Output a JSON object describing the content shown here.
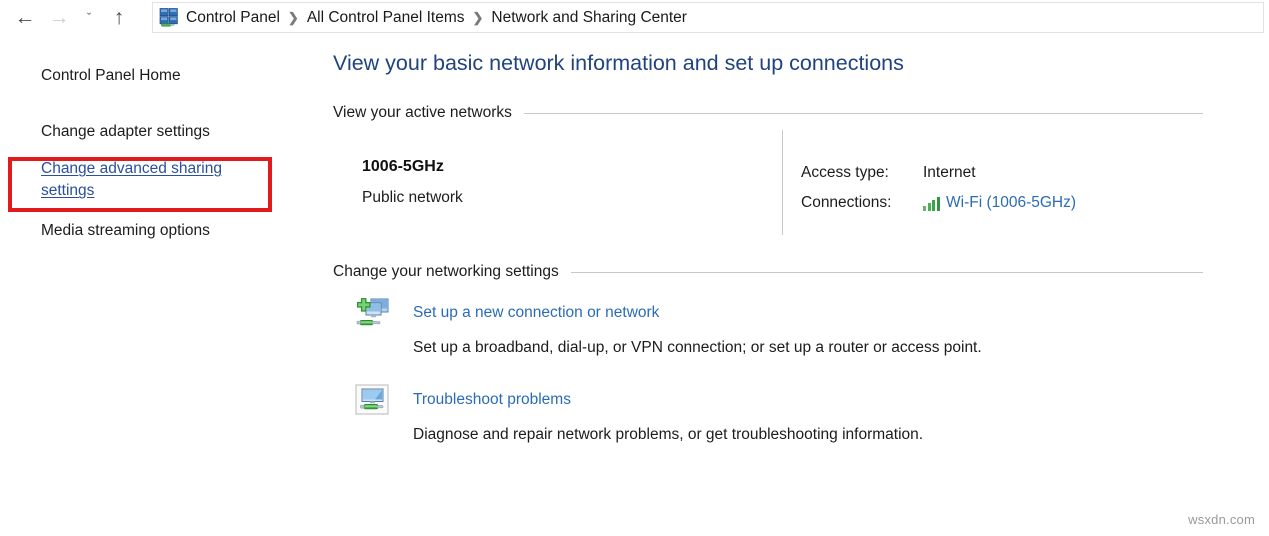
{
  "window": {
    "nav": {
      "back_icon": "arrow-left-icon",
      "forward_icon": "arrow-right-icon",
      "recent_icon": "chevron-down-icon",
      "up_icon": "arrow-up-icon",
      "back_glyph": "←",
      "forward_glyph": "→",
      "recent_glyph": "ˇ",
      "up_glyph": "↑"
    },
    "breadcrumb": {
      "icon": "network-sharing-center-icon",
      "separator": "❯",
      "items": [
        {
          "label": "Control Panel"
        },
        {
          "label": "All Control Panel Items"
        },
        {
          "label": "Network and Sharing Center"
        }
      ]
    }
  },
  "sidebar": {
    "items": [
      {
        "label": "Control Panel Home",
        "highlighted": false
      },
      {
        "label": "Change adapter settings",
        "highlighted": false
      },
      {
        "label": "Change advanced sharing settings",
        "highlighted": true
      },
      {
        "label": "Media streaming options",
        "highlighted": false
      }
    ],
    "highlight_color": "#e01b1b"
  },
  "main": {
    "title": "View your basic network information and set up connections",
    "title_color": "#21437f",
    "sections": {
      "active_networks": {
        "heading": "View your active networks",
        "network": {
          "name": "1006-5GHz",
          "type": "Public network",
          "properties": [
            {
              "label": "Access type:",
              "value": "Internet",
              "is_link": false
            },
            {
              "label": "Connections:",
              "value": "Wi-Fi (1006-5GHz)",
              "is_link": true,
              "icon": "wifi-signal-bars-icon"
            }
          ]
        }
      },
      "change_settings": {
        "heading": "Change your networking settings",
        "tasks": [
          {
            "icon": "new-connection-icon",
            "link": "Set up a new connection or network",
            "description": "Set up a broadband, dial-up, or VPN connection; or set up a router or access point."
          },
          {
            "icon": "troubleshoot-icon",
            "link": "Troubleshoot problems",
            "description": "Diagnose and repair network problems, or get troubleshooting information."
          }
        ]
      }
    }
  },
  "watermark": {
    "text": "wsxdn.com"
  },
  "colors": {
    "link": "#2a6cb5",
    "heading": "#21437f",
    "sidebar_link": "#2a4f9c",
    "highlight": "#e01b1b",
    "rule": "#c8c8c8"
  }
}
